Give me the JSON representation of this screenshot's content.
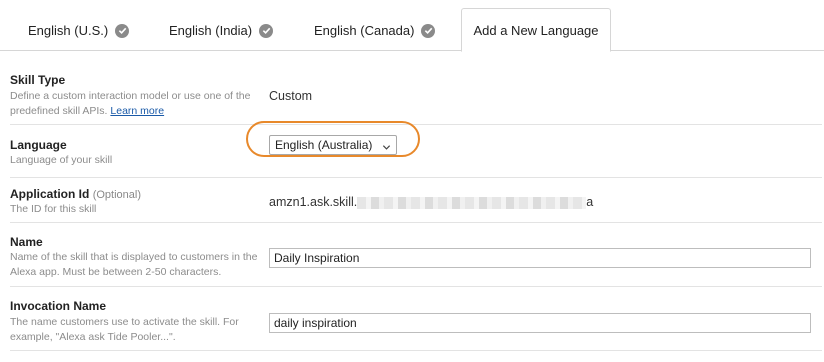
{
  "tabs": [
    {
      "label": "English (U.S.)",
      "icon": "check-circle-icon"
    },
    {
      "label": "English (India)",
      "icon": "check-circle-icon"
    },
    {
      "label": "English (Canada)",
      "icon": "check-circle-icon"
    }
  ],
  "active_tab": {
    "label": "Add a New Language"
  },
  "skill_type": {
    "label": "Skill Type",
    "description": "Define a custom interaction model or use one of the predefined skill APIs.",
    "learn_more": "Learn more",
    "value": "Custom"
  },
  "language": {
    "label": "Language",
    "description": "Language of your skill",
    "selected": "English (Australia)",
    "highlight_color": "#e8892b"
  },
  "application_id": {
    "label": "Application Id",
    "optional": "(Optional)",
    "description": "The ID for this skill",
    "value_prefix": "amzn1.ask.skill.",
    "value_suffix": "a"
  },
  "name": {
    "label": "Name",
    "description": "Name of the skill that is displayed to customers in the Alexa app. Must be between 2-50 characters.",
    "value": "Daily Inspiration"
  },
  "invocation_name": {
    "label": "Invocation Name",
    "description": "The name customers use to activate the skill. For example, \"Alexa ask Tide Pooler...\".",
    "value": "daily inspiration"
  }
}
